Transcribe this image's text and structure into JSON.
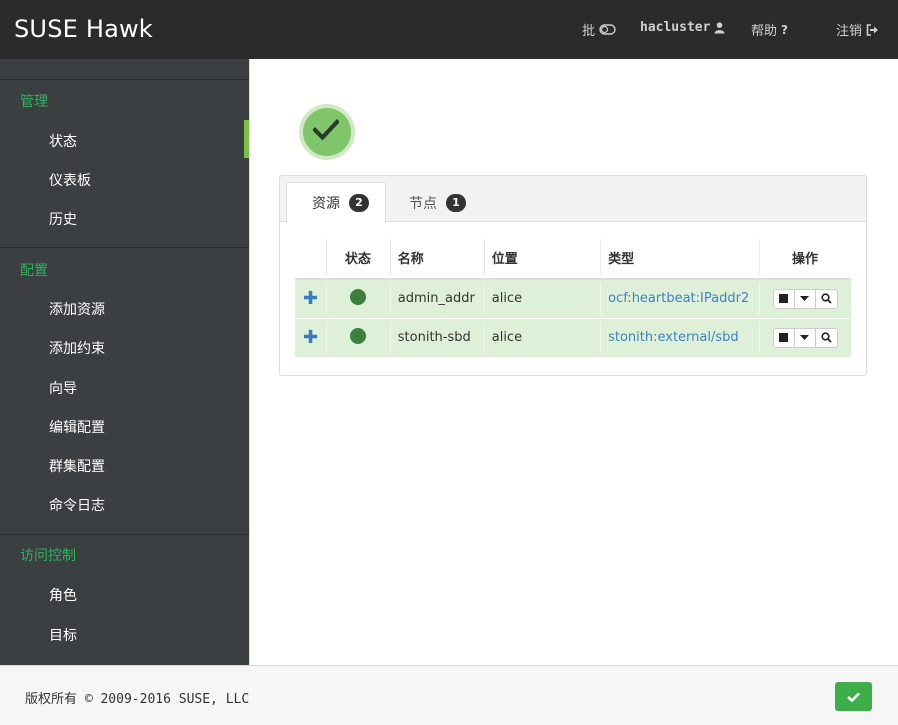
{
  "header": {
    "brand": "SUSE Hawk",
    "batch_label": "批",
    "user_label": "hacluster",
    "help_label": "帮助",
    "logout_label": "注销"
  },
  "sidebar": {
    "sections": [
      {
        "title": "管理",
        "items": [
          "状态",
          "仪表板",
          "历史"
        ]
      },
      {
        "title": "配置",
        "items": [
          "添加资源",
          "添加约束",
          "向导",
          "编辑配置",
          "群集配置",
          "命令日志"
        ]
      },
      {
        "title": "访问控制",
        "items": [
          "角色",
          "目标"
        ]
      }
    ],
    "active_item": "状态"
  },
  "tabs": [
    {
      "label": "资源",
      "count": "2"
    },
    {
      "label": "节点",
      "count": "1"
    }
  ],
  "table": {
    "headers": [
      "状态",
      "名称",
      "位置",
      "类型",
      "操作"
    ],
    "rows": [
      {
        "name": "admin_addr",
        "location": "alice",
        "type": "ocf:heartbeat:IPaddr2"
      },
      {
        "name": "stonith-sbd",
        "location": "alice",
        "type": "stonith:external/sbd"
      }
    ]
  },
  "footer": {
    "copyright": "版权所有 © 2009-2016 SUSE, LLC"
  },
  "colors": {
    "accent_green": "#2fb35e",
    "row_ok": "#dff0d8",
    "link": "#3a83c4"
  }
}
